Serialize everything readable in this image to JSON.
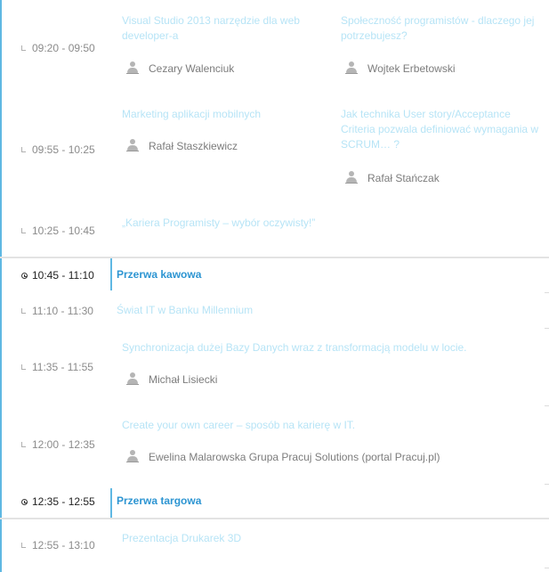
{
  "sessions": [
    {
      "time": "09:20 - 09:50",
      "title": "Visual Studio 2013 narzędzie dla web developer-a",
      "speaker": "Cezary Walenciuk"
    },
    {
      "time": "",
      "title": "Społeczność programistów - dlaczego jej potrzebujesz?",
      "speaker": "Wojtek Erbetowski"
    },
    {
      "time": "09:55 - 10:25",
      "title": "Marketing aplikacji mobilnych",
      "speaker": "Rafał Staszkiewicz"
    },
    {
      "time": "",
      "title": "Jak technika User story/Acceptance Criteria pozwala definiować wymagania w SCRUM… ?",
      "speaker": "Rafał Stańczak"
    },
    {
      "time": "10:25 - 10:45",
      "title": "„Kariera Programisty – wybór oczywisty!”",
      "speaker": ""
    },
    {
      "time": "11:10 - 11:30",
      "title": "Świat IT w Banku Millennium",
      "speaker": ""
    },
    {
      "time": "11:35 - 11:55",
      "title": "Synchronizacja dużej Bazy Danych wraz z transformacją modelu w locie.",
      "speaker": "Michał Lisiecki"
    },
    {
      "time": "12:00 - 12:35",
      "title": "Create your own career – sposób na karierę w IT.",
      "speaker": "Ewelina Malarowska Grupa Pracuj Solutions (portal Pracuj.pl)"
    },
    {
      "time": "12:55 - 13:10",
      "title": "Prezentacja Drukarek 3D",
      "speaker": ""
    }
  ],
  "breaks": [
    {
      "time": "10:45 - 11:10",
      "title": "Przerwa kawowa"
    },
    {
      "time": "12:35 - 12:55",
      "title": "Przerwa targowa"
    }
  ],
  "colors": {
    "accent": "#2d95d2",
    "faded_title": "#b7e4f6",
    "timeline": "#5fb8e3"
  },
  "icons": {
    "speaker": "person-icon",
    "break": "clock-icon",
    "time": "tick-icon"
  }
}
